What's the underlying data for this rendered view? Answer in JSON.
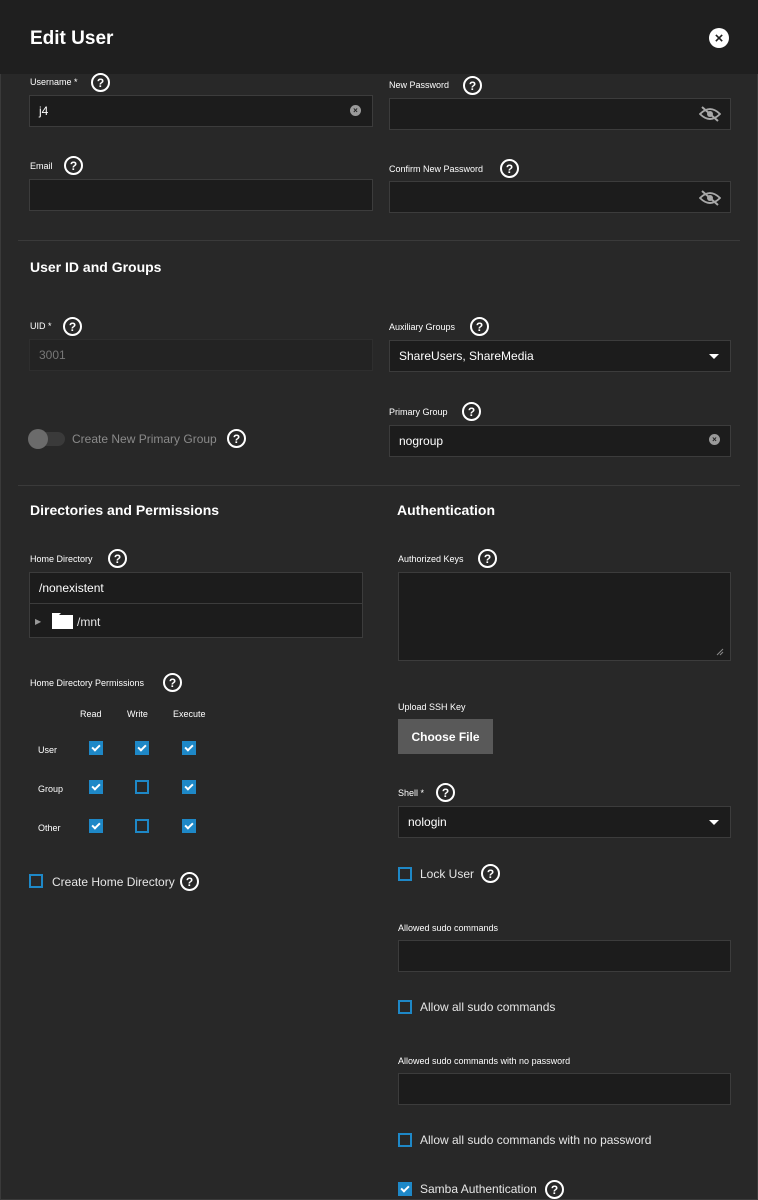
{
  "header": {
    "title": "Edit User"
  },
  "fields": {
    "username_label": "Username *",
    "username_value": "j4",
    "new_password_label": "New Password",
    "email_label": "Email",
    "confirm_password_label": "Confirm New Password"
  },
  "groups": {
    "section_title": "User ID and Groups",
    "uid_label": "UID *",
    "uid_value": "3001",
    "aux_groups_label": "Auxiliary Groups",
    "aux_groups_value": "ShareUsers, ShareMedia",
    "primary_group_label": "Primary Group",
    "primary_group_value": "nogroup",
    "create_primary_group_label": "Create New Primary Group"
  },
  "directories": {
    "section_title": "Directories and Permissions",
    "home_dir_label": "Home Directory",
    "home_dir_value": "/nonexistent",
    "tree_item": "/mnt",
    "permissions_label": "Home Directory Permissions",
    "columns": [
      "Read",
      "Write",
      "Execute"
    ],
    "rows": [
      {
        "label": "User",
        "checked": [
          true,
          true,
          true
        ]
      },
      {
        "label": "Group",
        "checked": [
          true,
          false,
          true
        ]
      },
      {
        "label": "Other",
        "checked": [
          true,
          false,
          true
        ]
      }
    ],
    "create_home_dir_label": "Create Home Directory"
  },
  "auth": {
    "section_title": "Authentication",
    "authorized_keys_label": "Authorized Keys",
    "upload_ssh_label": "Upload SSH Key",
    "choose_file_label": "Choose File",
    "shell_label": "Shell *",
    "shell_value": "nologin",
    "lock_user_label": "Lock User",
    "sudo_commands_label": "Allowed sudo commands",
    "allow_all_sudo_label": "Allow all sudo commands",
    "sudo_nopw_label": "Allowed sudo commands with no password",
    "allow_all_sudo_nopw_label": "Allow all sudo commands with no password",
    "samba_auth_label": "Samba Authentication"
  },
  "icons": {
    "help": "?",
    "close": "×",
    "clear": "×"
  },
  "colors": {
    "accent": "#1e88c7",
    "background": "#282828",
    "header": "#1f1f1f"
  }
}
